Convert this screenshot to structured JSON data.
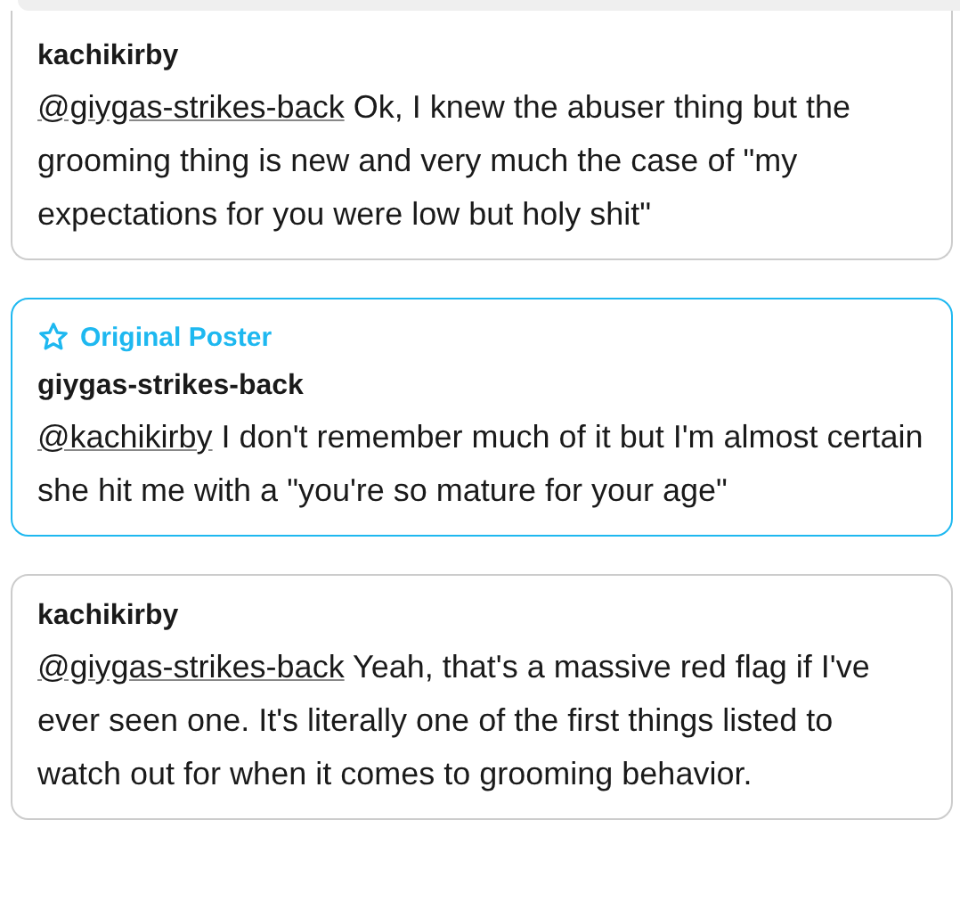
{
  "replies": [
    {
      "username": "kachikirby",
      "original_poster": false,
      "mention": "@giygas-strikes-back",
      "text": "Ok, I knew the abuser thing but the grooming thing is new and very much the case of \"my expectations for you were low but holy shit\""
    },
    {
      "username": "giygas-strikes-back",
      "original_poster": true,
      "badge": "Original Poster",
      "mention": "@kachikirby",
      "text": "I don't remember much of it but I'm almost certain she hit me with a \"you're so mature for your age\""
    },
    {
      "username": "kachikirby",
      "original_poster": false,
      "mention": "@giygas-strikes-back",
      "text": "Yeah, that's a massive red flag if I've ever seen one. It's literally one of the first things listed to watch out for when it comes to grooming behavior."
    }
  ]
}
